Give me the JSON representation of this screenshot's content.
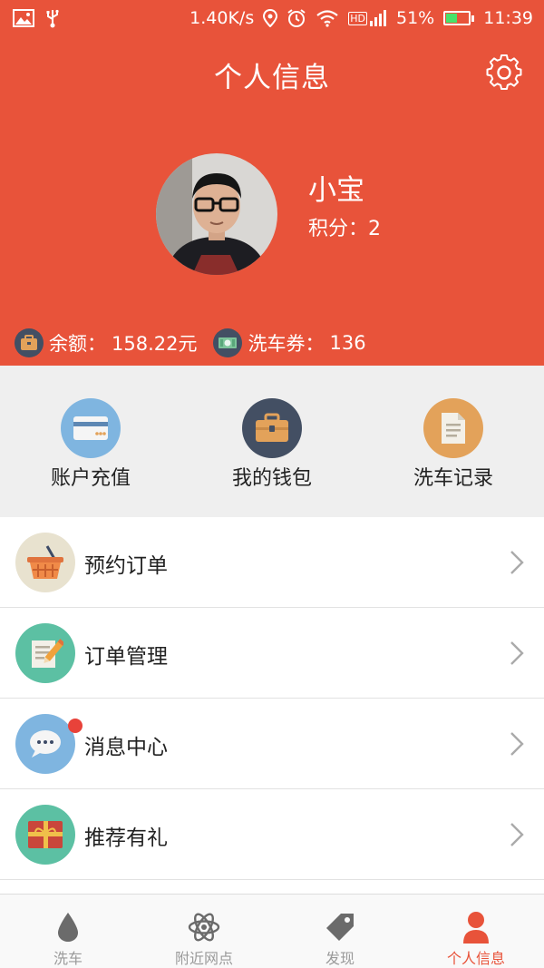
{
  "status_bar": {
    "speed": "1.40K/s",
    "network": "HD",
    "battery": "51%",
    "battery_level": 0.51,
    "time": "11:39"
  },
  "header": {
    "title": "个人信息",
    "settings_icon": "gear-icon"
  },
  "profile": {
    "name": "小宝",
    "points_label": "积分：",
    "points": "2"
  },
  "balances": {
    "balance_label": "余额：",
    "balance_value": "158.22元",
    "voucher_label": "洗车券：",
    "voucher_value": "136"
  },
  "quick_actions": [
    {
      "label": "账户充值",
      "icon": "card-icon",
      "color": "#7fb5e0"
    },
    {
      "label": "我的钱包",
      "icon": "wallet-icon",
      "color": "#434f63"
    },
    {
      "label": "洗车记录",
      "icon": "document-icon",
      "color": "#e3a25a"
    }
  ],
  "menu": [
    {
      "label": "预约订单",
      "icon": "basket-icon",
      "color": "#e8e2cf"
    },
    {
      "label": "订单管理",
      "icon": "edit-note-icon",
      "color": "#5cc0a3"
    },
    {
      "label": "消息中心",
      "icon": "chat-bubble-icon",
      "color": "#7fb5e0",
      "has_badge": true
    },
    {
      "label": "推荐有礼",
      "icon": "gift-icon",
      "color": "#5cc0a3"
    }
  ],
  "tabs": [
    {
      "label": "洗车",
      "icon": "water-drop-icon",
      "active": false
    },
    {
      "label": "附近网点",
      "icon": "atom-icon",
      "active": false
    },
    {
      "label": "发现",
      "icon": "tag-icon",
      "active": false
    },
    {
      "label": "个人信息",
      "icon": "person-icon",
      "active": true
    }
  ],
  "colors": {
    "header_bg": "#e8533a",
    "quick_bg": "#efefef",
    "active_tab": "#e8533a",
    "inactive_tab": "#9a9a9a"
  }
}
